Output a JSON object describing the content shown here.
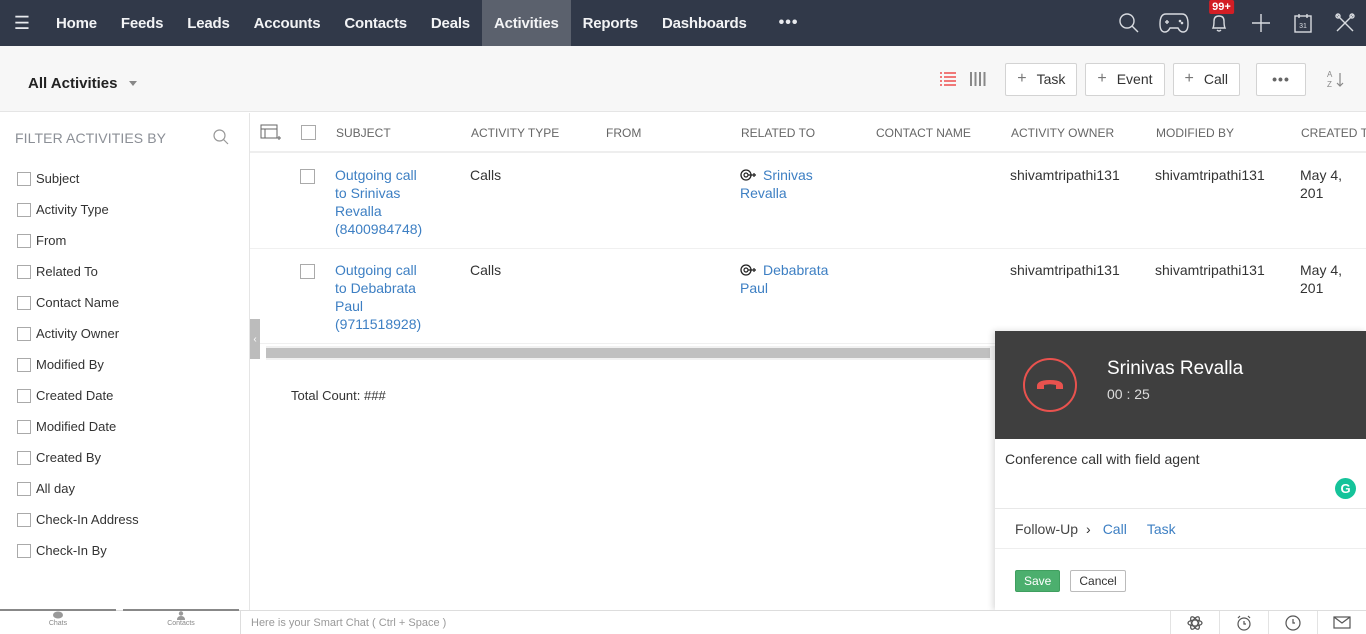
{
  "nav": {
    "items": [
      "Home",
      "Feeds",
      "Leads",
      "Accounts",
      "Contacts",
      "Deals",
      "Activities",
      "Reports",
      "Dashboards"
    ],
    "active": "Activities",
    "more_label": "•••",
    "notification_badge": "99+",
    "icons": [
      "search-icon",
      "gamepad-icon",
      "bell-icon",
      "plus-icon",
      "calendar-icon",
      "tools-icon"
    ],
    "calendar_day": "31"
  },
  "subheader": {
    "view_label": "All Activities",
    "buttons": {
      "task": "Task",
      "event": "Event",
      "call": "Call",
      "more": "•••"
    },
    "plus": "+",
    "sort_label": "A Z ↓"
  },
  "sidebar": {
    "title": "FILTER ACTIVITIES BY",
    "filters": [
      "Subject",
      "Activity Type",
      "From",
      "Related To",
      "Contact Name",
      "Activity Owner",
      "Modified By",
      "Created Date",
      "Modified Date",
      "Created By",
      "All day",
      "Check-In Address",
      "Check-In By"
    ]
  },
  "table": {
    "columns": [
      "SUBJECT",
      "ACTIVITY TYPE",
      "FROM",
      "RELATED TO",
      "CONTACT NAME",
      "ACTIVITY OWNER",
      "MODIFIED BY",
      "CREATED T"
    ],
    "rows": [
      {
        "subject_lines": [
          "Outgoing call",
          "to Srinivas",
          "Revalla",
          "(8400984748)"
        ],
        "activity_type": "Calls",
        "from": "",
        "related_to_lines": [
          "Srinivas",
          "Revalla"
        ],
        "contact_name": "",
        "activity_owner": "shivamtripathi131",
        "modified_by": "shivamtripathi131",
        "created": "May 4, 201"
      },
      {
        "subject_lines": [
          "Outgoing call",
          "to Debabrata",
          "Paul",
          "(9711518928)"
        ],
        "activity_type": "Calls",
        "from": "",
        "related_to_lines": [
          "Debabrata",
          "Paul"
        ],
        "contact_name": "",
        "activity_owner": "shivamtripathi131",
        "modified_by": "shivamtripathi131",
        "created": "May 4, 201"
      }
    ],
    "total_count": "Total Count: ###",
    "collapse_glyph": "‹"
  },
  "call_panel": {
    "caller": "Srinivas Revalla",
    "timer": "00 : 25",
    "note": "Conference call with field agent",
    "grammarly_glyph": "G",
    "followup_label": "Follow-Up",
    "followup_links": [
      "Call",
      "Task"
    ],
    "save_label": "Save",
    "cancel_label": "Cancel"
  },
  "bottombar": {
    "tabs": [
      "Chats",
      "Contacts"
    ],
    "smart_chat_placeholder": "Here is your Smart Chat ( Ctrl + Space )"
  },
  "colors": {
    "nav_bg": "#313949",
    "nav_active": "#5b616d",
    "link": "#3d7fc3",
    "hangup": "#e9524e",
    "save": "#4caf6e",
    "badge": "#d31e25"
  }
}
